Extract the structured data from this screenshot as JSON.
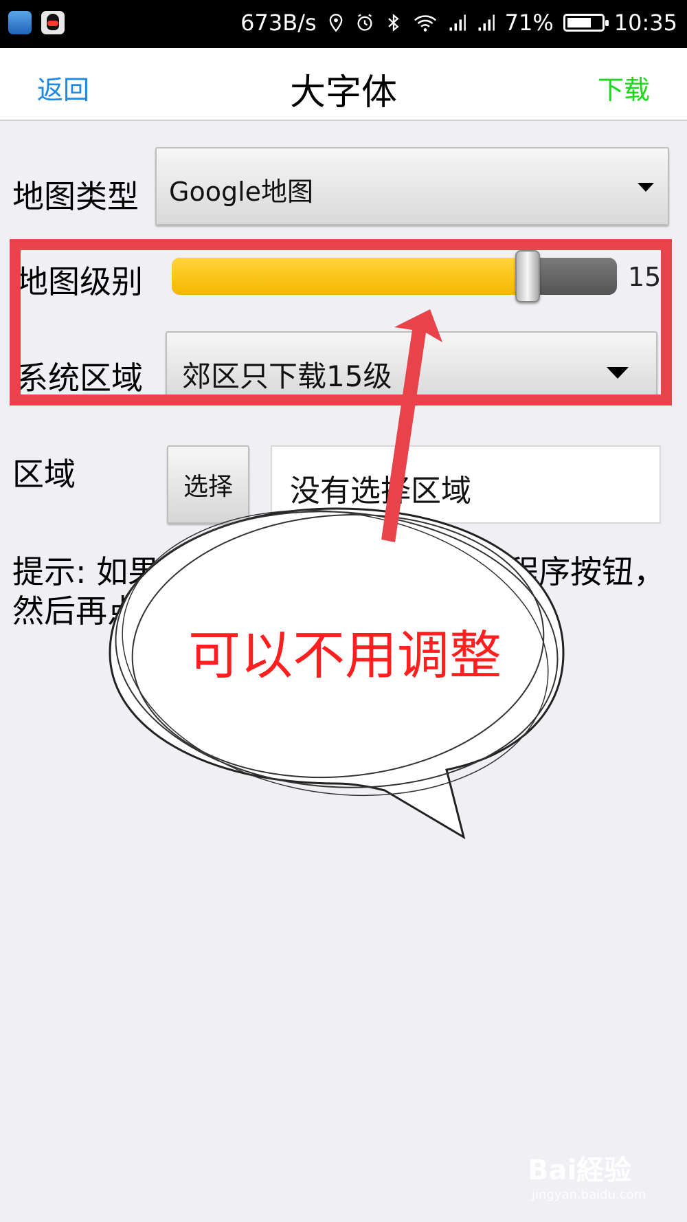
{
  "status_bar": {
    "network_speed": "673B/s",
    "battery_percent": "71%",
    "battery_level": 0.71,
    "time": "10:35",
    "icons": [
      "shield-app-icon",
      "qq-app-icon",
      "location-icon",
      "alarm-icon",
      "bluetooth-icon",
      "wifi-icon",
      "signal-icon",
      "signal-icon",
      "battery-icon"
    ]
  },
  "navbar": {
    "back_label": "返回",
    "title": "大字体",
    "download_label": "下载"
  },
  "form": {
    "map_type_label": "地图类型",
    "map_type_value": "Google地图",
    "map_level_label": "地图级别",
    "map_level_value": "15",
    "map_level_fraction": 0.8,
    "system_area_label": "系统区域",
    "system_area_value": "郊区只下载15级",
    "area_label": "区域",
    "select_button_label": "选择",
    "area_value": "没有选择区域"
  },
  "tip": "提示: 如果你要下载的区域下载。在程序按钮，然后再点在地图上自行建立",
  "annotation": {
    "bubble_text": "可以不用调整"
  },
  "watermark": {
    "main": "Bai経验",
    "sub": "jingyan.baidu.com"
  },
  "colors": {
    "nav_link": "#1e88e5",
    "download": "#19d919",
    "highlight": "#e8434a",
    "slider_fill": "#ffc400",
    "bubble_text": "#ff1f1f"
  }
}
